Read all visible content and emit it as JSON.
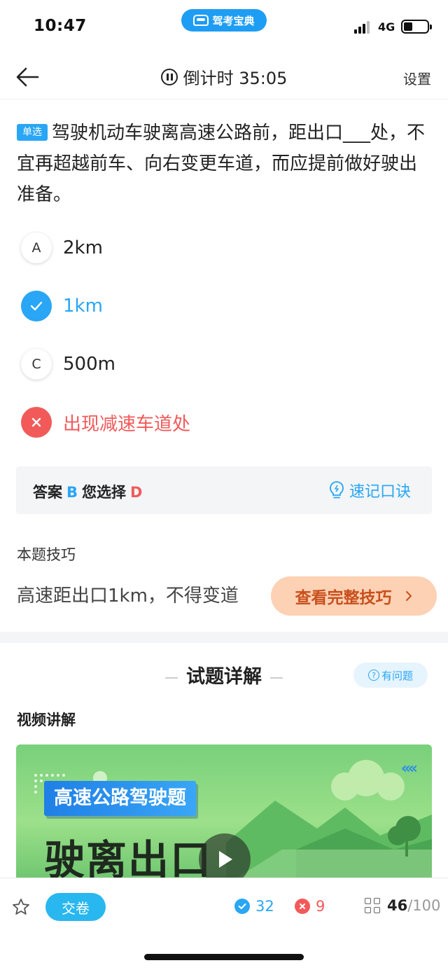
{
  "status_bar": {
    "time": "10:47",
    "app_name": "驾考宝典",
    "network": "4G"
  },
  "nav": {
    "back_icon": "arrow-left-icon",
    "timer_label": "倒计时 35:05",
    "settings_label": "设置"
  },
  "question": {
    "type_tag": "单选",
    "text": "驾驶机动车驶离高速公路前，距出口___处，不宜再超越前车、向右变更车道，而应提前做好驶出准备。",
    "options": [
      {
        "marker": "A",
        "text": "2km",
        "state": "normal"
      },
      {
        "marker": "✓",
        "text": "1km",
        "state": "correct"
      },
      {
        "marker": "C",
        "text": "500m",
        "state": "normal"
      },
      {
        "marker": "✕",
        "text": "出现减速车道处",
        "state": "wrong"
      }
    ]
  },
  "answer": {
    "label": "答案",
    "correct": "B",
    "chosen_label": "您选择",
    "chosen": "D",
    "mnemonic_label": "速记口诀"
  },
  "tip": {
    "title": "本题技巧",
    "text": "高速距出口1km，不得变道",
    "button_label": "查看完整技巧"
  },
  "explain": {
    "title": "试题详解",
    "problem_label": "有问题",
    "video_label": "视频讲解"
  },
  "video": {
    "tag": "高速公路驾驶题",
    "heading": "驶离出口"
  },
  "bottom": {
    "submit_label": "交卷",
    "correct_count": "32",
    "wrong_count": "9",
    "current": "46",
    "total": "/100"
  },
  "colors": {
    "accent": "#29a6f5",
    "error": "#f25a5a",
    "tip_bg": "#fdd1b4"
  }
}
